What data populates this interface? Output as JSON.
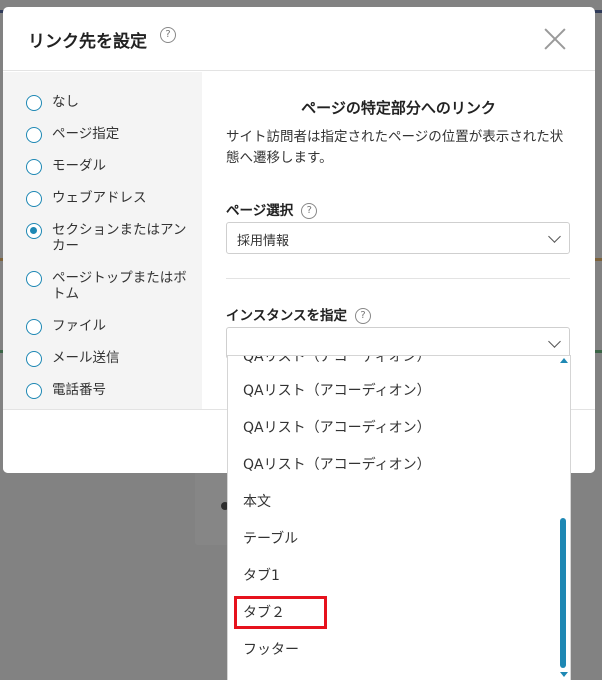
{
  "modal": {
    "title": "リンク先を設定",
    "help_glyph": "?"
  },
  "link_types": [
    {
      "label": "なし",
      "checked": false
    },
    {
      "label": "ページ指定",
      "checked": false
    },
    {
      "label": "モーダル",
      "checked": false
    },
    {
      "label": "ウェブアドレス",
      "checked": false
    },
    {
      "label": "セクションまたはアンカー",
      "checked": true
    },
    {
      "label": "ページトップまたはボトム",
      "checked": false
    },
    {
      "label": "ファイル",
      "checked": false
    },
    {
      "label": "メール送信",
      "checked": false
    },
    {
      "label": "電話番号",
      "checked": false
    }
  ],
  "content": {
    "title": "ページの特定部分へのリンク",
    "description": "サイト訪問者は指定されたページの位置が表示された状態へ遷移します。",
    "page_select_label": "ページ選択",
    "page_select_value": "採用情報",
    "instance_label": "インスタンスを指定",
    "instance_value": ""
  },
  "dropdown": {
    "partial_item": "QAリスト（アコーディオン）",
    "items": [
      "QAリスト（アコーディオン）",
      "QAリスト（アコーディオン）",
      "QAリスト（アコーディオン）",
      "本文",
      "テーブル",
      "タブ1",
      "タブ２",
      "フッター"
    ],
    "highlighted_item": "タブ２"
  },
  "colors": {
    "accent": "#1e88b4",
    "highlight": "#e6121d",
    "sidebar_bg": "#f4f4f4"
  }
}
